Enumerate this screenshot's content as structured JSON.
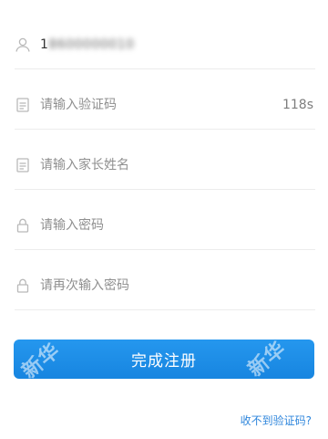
{
  "form": {
    "phone": {
      "icon": "user-icon",
      "value_prefix": "1",
      "value_masked": "8600000010"
    },
    "verify_code": {
      "icon": "sms-code-icon",
      "placeholder": "请输入验证码",
      "countdown": "118s"
    },
    "parent_name": {
      "icon": "id-card-icon",
      "placeholder": "请输入家长姓名"
    },
    "password": {
      "icon": "lock-icon",
      "placeholder": "请输入密码"
    },
    "password_confirm": {
      "icon": "lock-icon",
      "placeholder": "请再次输入密码"
    }
  },
  "actions": {
    "submit_label": "完成注册",
    "help_link": "收不到验证码?"
  },
  "watermark": {
    "text_left": "新华",
    "text_right": "新华"
  },
  "colors": {
    "accent": "#1f8fe8",
    "icon": "#b9b9b9",
    "placeholder": "#8f8f8f",
    "link": "#2f86dc",
    "divider": "#ececec"
  }
}
